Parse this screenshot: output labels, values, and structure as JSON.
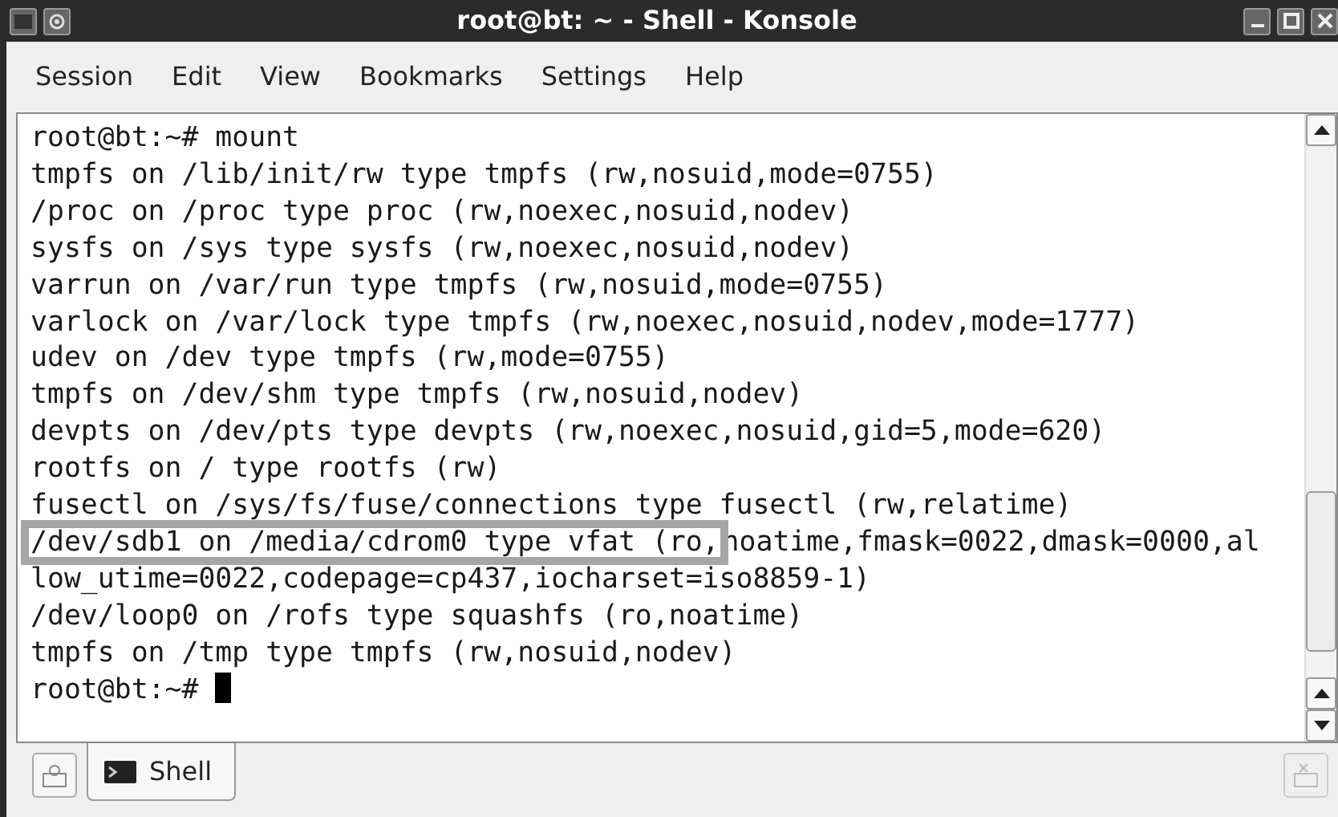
{
  "window": {
    "title": "root@bt: ~ - Shell - Konsole"
  },
  "menu": [
    "Session",
    "Edit",
    "View",
    "Bookmarks",
    "Settings",
    "Help"
  ],
  "terminal": {
    "lines": [
      {
        "segments": [
          {
            "text": "root@bt:~# mount",
            "highlighted": false
          }
        ]
      },
      {
        "segments": [
          {
            "text": "tmpfs on /lib/init/rw type tmpfs (rw,nosuid,mode=0755)",
            "highlighted": false
          }
        ]
      },
      {
        "segments": [
          {
            "text": "/proc on /proc type proc (rw,noexec,nosuid,nodev)",
            "highlighted": false
          }
        ]
      },
      {
        "segments": [
          {
            "text": "sysfs on /sys type sysfs (rw,noexec,nosuid,nodev)",
            "highlighted": false
          }
        ]
      },
      {
        "segments": [
          {
            "text": "varrun on /var/run type tmpfs (rw,nosuid,mode=0755)",
            "highlighted": false
          }
        ]
      },
      {
        "segments": [
          {
            "text": "varlock on /var/lock type tmpfs (rw,noexec,nosuid,nodev,mode=1777)",
            "highlighted": false
          }
        ]
      },
      {
        "segments": [
          {
            "text": "udev on /dev type tmpfs (rw,mode=0755)",
            "highlighted": false
          }
        ]
      },
      {
        "segments": [
          {
            "text": "tmpfs on /dev/shm type tmpfs (rw,nosuid,nodev)",
            "highlighted": false
          }
        ]
      },
      {
        "segments": [
          {
            "text": "devpts on /dev/pts type devpts (rw,noexec,nosuid,gid=5,mode=620)",
            "highlighted": false
          }
        ]
      },
      {
        "segments": [
          {
            "text": "rootfs on / type rootfs (rw)",
            "highlighted": false
          }
        ]
      },
      {
        "segments": [
          {
            "text": "fusectl on /sys/fs/fuse/connections type fusectl (rw,relatime)",
            "highlighted": false
          }
        ]
      },
      {
        "segments": [
          {
            "text": "/dev/sdb1 on /media/cdrom0 type vfat (ro,",
            "highlighted": true
          },
          {
            "text": "noatime,fmask=0022,dmask=0000,al",
            "highlighted": false
          }
        ]
      },
      {
        "segments": [
          {
            "text": "low_utime=0022,codepage=cp437,iocharset=iso8859-1)",
            "highlighted": false
          }
        ]
      },
      {
        "segments": [
          {
            "text": "/dev/loop0 on /rofs type squashfs (ro,noatime)",
            "highlighted": false
          }
        ]
      },
      {
        "segments": [
          {
            "text": "tmpfs on /tmp type tmpfs (rw,nosuid,nodev)",
            "highlighted": false
          }
        ]
      },
      {
        "segments": [
          {
            "text": "root@bt:~#",
            "highlighted": false
          }
        ],
        "cursor": true
      }
    ]
  },
  "tabs": [
    {
      "label": "Shell",
      "selected": true
    }
  ]
}
